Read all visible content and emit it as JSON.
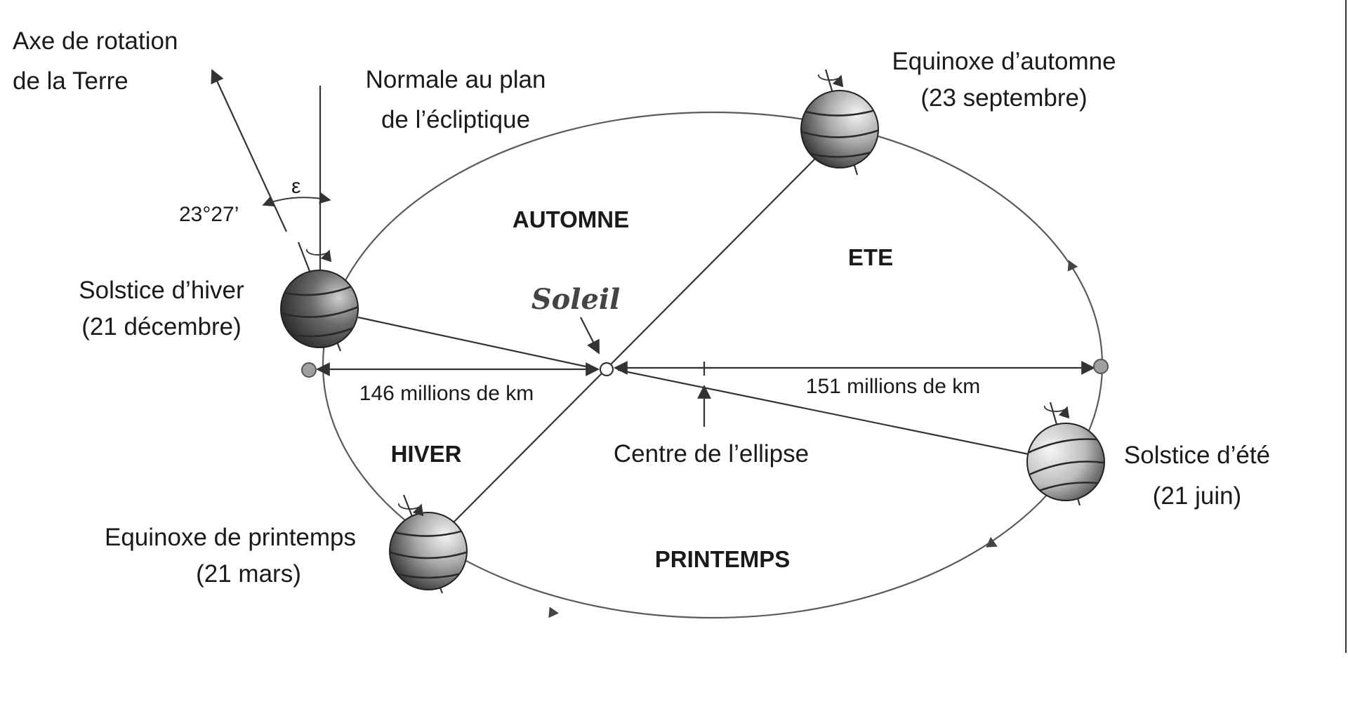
{
  "labels": {
    "axis_line1": "Axe de rotation",
    "axis_line2": "de la Terre",
    "normal_line1": "Normale au plan",
    "normal_line2": "de l’écliptique",
    "epsilon": "ε",
    "tilt": "23°27’",
    "winter_solstice_line1": "Solstice d’hiver",
    "winter_solstice_line2": "(21 décembre)",
    "autumn_equinox_line1": "Equinoxe d’automne",
    "autumn_equinox_line2": "(23 septembre)",
    "summer_solstice_line1": "Solstice d’été",
    "summer_solstice_line2": "(21 juin)",
    "spring_equinox_line1": "Equinoxe de printemps",
    "spring_equinox_line2": "(21 mars)",
    "sun": "Soleil",
    "perihelion_distance": "146 millions de km",
    "aphelion_distance": "151 millions de km",
    "ellipse_center": "Centre de l’ellipse"
  },
  "seasons": {
    "autumn": "AUTOMNE",
    "summer": "ETE",
    "winter": "HIVER",
    "spring": "PRINTEMPS"
  },
  "colors": {
    "earth_dark": "#2b2b2b",
    "earth_light": "#f2f2f2",
    "ink": "#1a1a1a"
  }
}
